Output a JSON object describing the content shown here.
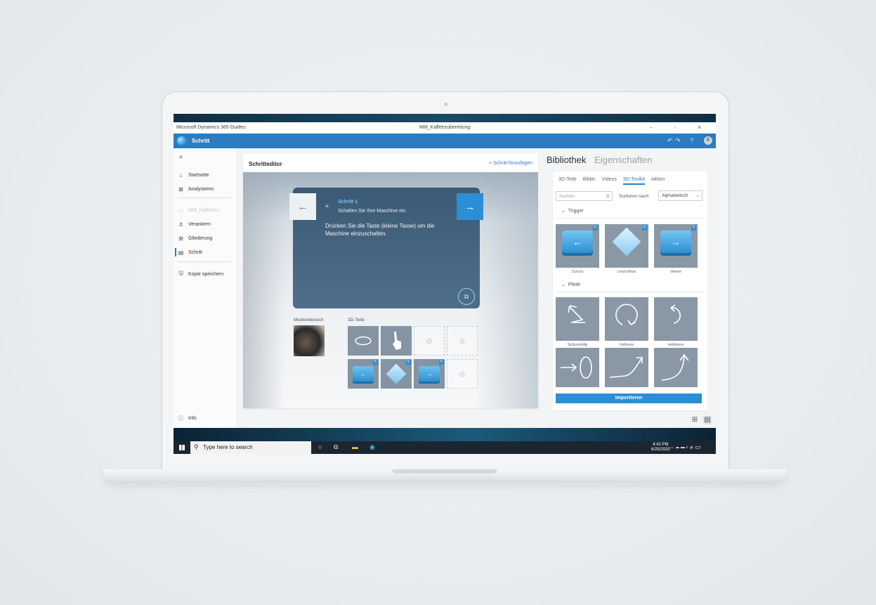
{
  "window": {
    "app_title": "Microsoft Dynamics 365 Guides",
    "document_title": "MM_Kaffeezubereitung",
    "controls": "– ▫ ✕"
  },
  "appbar": {
    "title": "Schritt",
    "icons": [
      "undo-icon",
      "redo-icon",
      "help-icon",
      "avatar"
    ],
    "help": "?",
    "avatar": "8"
  },
  "nav": {
    "menu_icon": "≡",
    "items": [
      {
        "label": "Startseite",
        "icon": "⌂"
      },
      {
        "label": "Analysieren",
        "icon": "⊠"
      },
      {
        "label": "MM_Kaffeezu...",
        "icon": "▭"
      },
      {
        "label": "Verankern",
        "icon": "⚓"
      },
      {
        "label": "Gliederung",
        "icon": "⊞"
      },
      {
        "label": "Schritt",
        "icon": "▤"
      },
      {
        "label": "Kopie speichern",
        "icon": "🖫"
      }
    ],
    "info_label": "Info",
    "info_icon": "ⓘ"
  },
  "editor": {
    "header": "Schritteditor",
    "add_step": "+ Schritt hinzufügen",
    "card": {
      "step_title": "Schritt 1",
      "step_subtitle": "Schalten Sie Ihre Maschine ein",
      "body": "Drücken Sie die Taste (kleine Tasse) um die Maschine einzuschalten.",
      "prev": "←",
      "next": "→",
      "list_icon": "≡",
      "capture_icon": "⧉"
    },
    "media_label": "Medienbereich",
    "parts_label": "3D-Teile"
  },
  "library": {
    "tabs": [
      "Bibliothek",
      "Eigenschaften"
    ],
    "subtabs": [
      "3D-Teile",
      "Bilder",
      "Videos",
      "3D-Toolkit",
      "Aktion"
    ],
    "active_subtab": "3D-Toolkit",
    "search_placeholder": "Suchen",
    "sort_label": "Sortieren nach",
    "sort_value": "Alphabetisch",
    "sections": [
      {
        "name": "Trigger",
        "items": [
          "Zurück",
          "Unsichtbar",
          "Weiter"
        ]
      },
      {
        "name": "Pfeile",
        "items": [
          "Spitzwinklig",
          "Vollkreis",
          "Halbkreis"
        ]
      }
    ],
    "import_button": "Importieren"
  },
  "taskbar": {
    "search_placeholder": "Type here to search",
    "time": "4:43 PM",
    "date": "6/25/2020"
  },
  "colors": {
    "accent": "#2b7cc0",
    "card_bg": "#3c5a75",
    "step_title": "#78c7f2",
    "tile_blue": "#2d8fd2"
  }
}
